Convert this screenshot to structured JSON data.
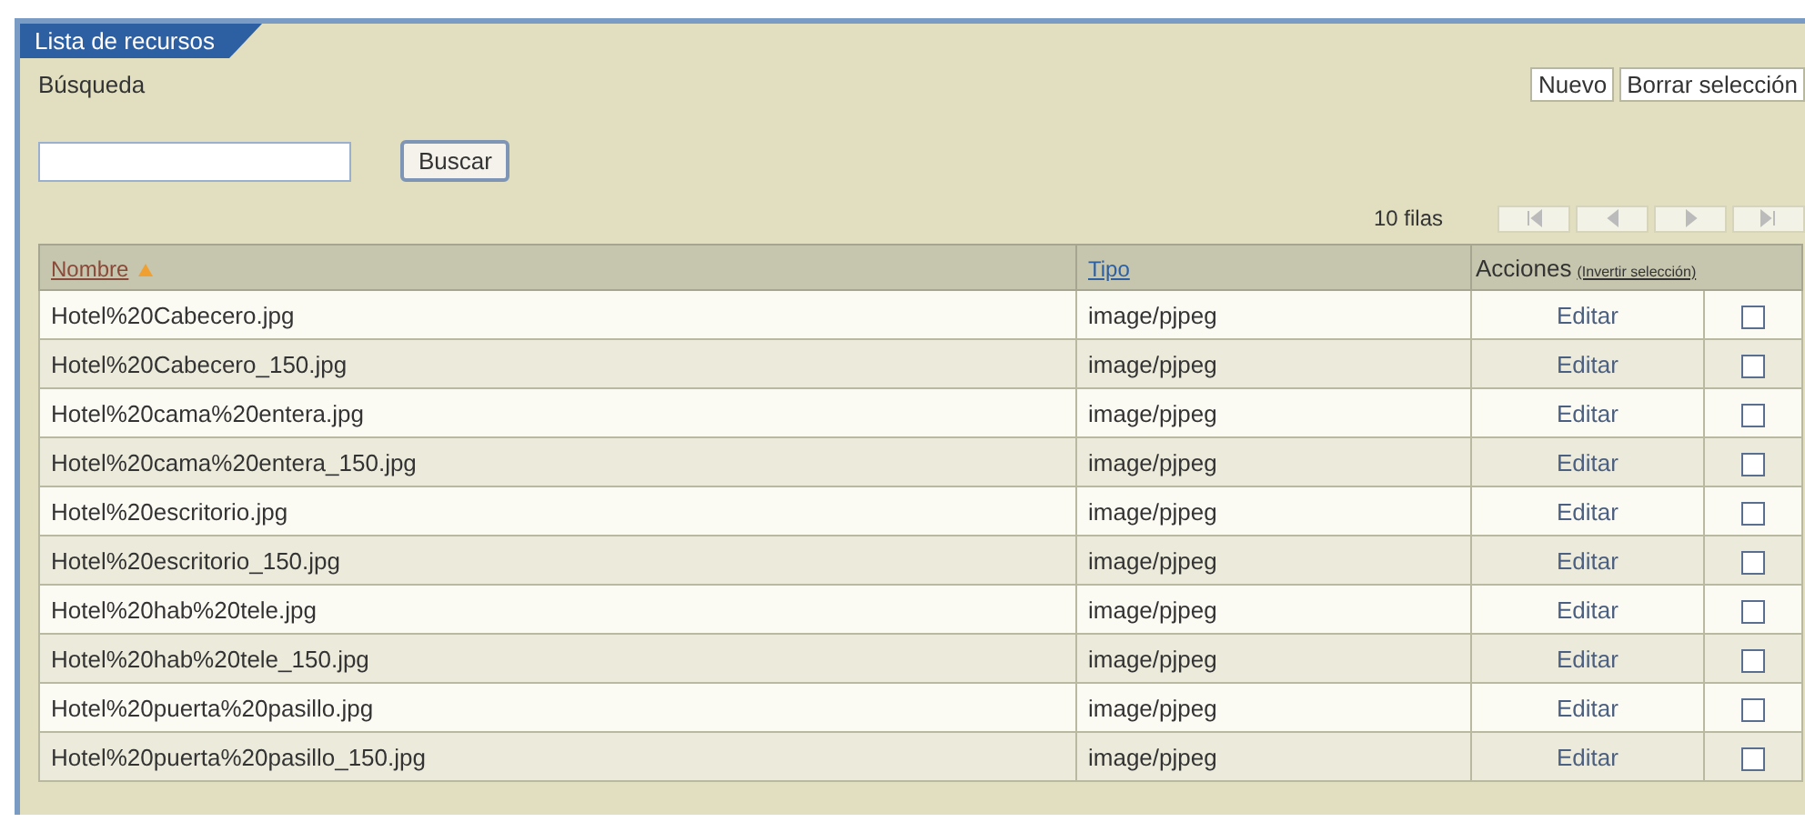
{
  "panel": {
    "title": "Lista de recursos"
  },
  "search": {
    "label": "Búsqueda",
    "button": "Buscar"
  },
  "actions": [
    "Nuevo",
    "Borrar selección"
  ],
  "pager": {
    "rows_label": "10 filas",
    "buttons": [
      {
        "kind": "first",
        "disabled": true
      },
      {
        "kind": "prev",
        "disabled": true
      },
      {
        "kind": "next",
        "disabled": true
      },
      {
        "kind": "last",
        "disabled": true
      }
    ]
  },
  "table": {
    "columns": [
      {
        "label": "Nombre",
        "sorted": true
      },
      {
        "label": "Tipo",
        "sorted": false
      },
      {
        "label": "Acciones",
        "link": "(Invertir selección)"
      }
    ],
    "rows": [
      {
        "name": "Hotel%20Cabecero.jpg",
        "type": "image/pjpeg",
        "action": "Editar",
        "checked": false
      },
      {
        "name": "Hotel%20Cabecero_150.jpg",
        "type": "image/pjpeg",
        "action": "Editar",
        "checked": false
      },
      {
        "name": "Hotel%20cama%20entera.jpg",
        "type": "image/pjpeg",
        "action": "Editar",
        "checked": false
      },
      {
        "name": "Hotel%20cama%20entera_150.jpg",
        "type": "image/pjpeg",
        "action": "Editar",
        "checked": false
      },
      {
        "name": "Hotel%20escritorio.jpg",
        "type": "image/pjpeg",
        "action": "Editar",
        "checked": false
      },
      {
        "name": "Hotel%20escritorio_150.jpg",
        "type": "image/pjpeg",
        "action": "Editar",
        "checked": false
      },
      {
        "name": "Hotel%20hab%20tele.jpg",
        "type": "image/pjpeg",
        "action": "Editar",
        "checked": false
      },
      {
        "name": "Hotel%20hab%20tele_150.jpg",
        "type": "image/pjpeg",
        "action": "Editar",
        "checked": false
      },
      {
        "name": "Hotel%20puerta%20pasillo.jpg",
        "type": "image/pjpeg",
        "action": "Editar",
        "checked": false
      },
      {
        "name": "Hotel%20puerta%20pasillo_150.jpg",
        "type": "image/pjpeg",
        "action": "Editar",
        "checked": false
      }
    ]
  }
}
